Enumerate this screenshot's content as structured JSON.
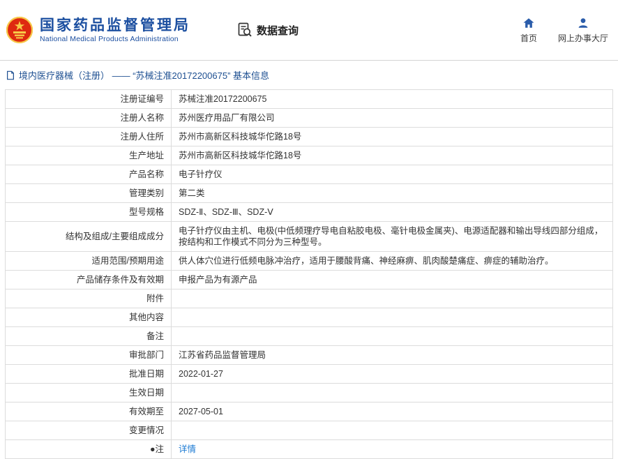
{
  "header": {
    "agency_name": "国家药品监督管理局",
    "agency_name_en": "National Medical Products Administration",
    "data_query_label": "数据查询",
    "nav": [
      {
        "label": "首页",
        "icon": "home-icon"
      },
      {
        "label": "网上办事大厅",
        "icon": "user-icon"
      }
    ]
  },
  "page_title": "境内医疗器械（注册） —— “苏械注准20172200675” 基本信息",
  "info_table": {
    "rows": [
      {
        "label": "注册证编号",
        "value": "苏械注准20172200675"
      },
      {
        "label": "注册人名称",
        "value": "苏州医疗用品厂有限公司"
      },
      {
        "label": "注册人住所",
        "value": "苏州市高新区科技城华佗路18号"
      },
      {
        "label": "生产地址",
        "value": "苏州市高新区科技城华佗路18号"
      },
      {
        "label": "产品名称",
        "value": "电子针疗仪"
      },
      {
        "label": "管理类别",
        "value": "第二类"
      },
      {
        "label": "型号规格",
        "value": "SDZ-Ⅱ、SDZ-Ⅲ、SDZ-Ⅴ"
      },
      {
        "label": "结构及组成/主要组成成分",
        "value": "电子针疗仪由主机、电极(中低频理疗导电自粘胶电极、毫针电极金属夹)、电源适配器和输出导线四部分组成，按结构和工作模式不同分为三种型号。"
      },
      {
        "label": "适用范围/预期用途",
        "value": "供人体穴位进行低频电脉冲治疗，适用于腰酸背痛、神经麻痹、肌肉酸楚痛症、痹症的辅助治疗。"
      },
      {
        "label": "产品储存条件及有效期",
        "value": "申报产品为有源产品"
      },
      {
        "label": "附件",
        "value": ""
      },
      {
        "label": "其他内容",
        "value": ""
      },
      {
        "label": "备注",
        "value": ""
      },
      {
        "label": "审批部门",
        "value": "江苏省药品监督管理局"
      },
      {
        "label": "批准日期",
        "value": "2022-01-27"
      },
      {
        "label": "生效日期",
        "value": ""
      },
      {
        "label": "有效期至",
        "value": "2027-05-01"
      },
      {
        "label": "变更情况",
        "value": ""
      },
      {
        "label": "●注",
        "value": "详情",
        "is_link": true
      }
    ]
  },
  "colors": {
    "brand_blue": "#1c4fa0",
    "link_blue": "#1b7ad3",
    "border_gray": "#dcdcdc",
    "emblem_red": "#de2910",
    "emblem_gold": "#f7c948"
  }
}
